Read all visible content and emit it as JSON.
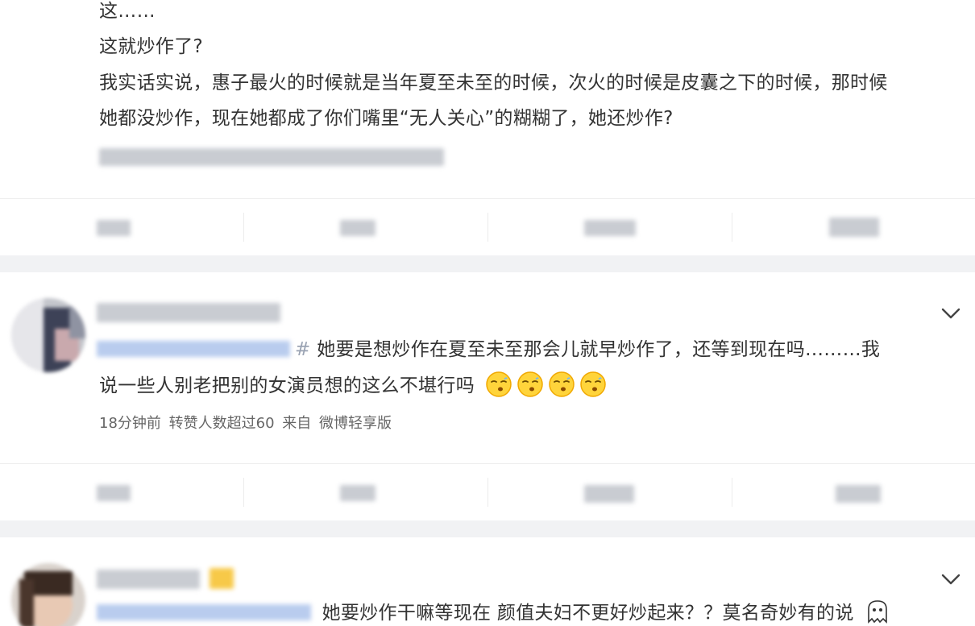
{
  "post": {
    "lines": [
      "这……",
      "这就炒作了?",
      "我实话实说，惠子最火的时候就是当年夏至未至的时候，次火的时候是皮囊之下的时候，那时候",
      "她都没炒作，现在她都成了你们嘴里“无人关心”的糊糊了，她还炒作?"
    ]
  },
  "comments": [
    {
      "hash": "#",
      "text_line1": "她要是想炒作在夏至未至那会儿就早炒作了，还等到现在吗………我",
      "text_line2": "说一些人别老把别的女演员想的这么不堪行吗",
      "meta": "18分钟前  转赞人数超过60  来自 微博轻享版"
    },
    {
      "text_line1": "她要炒作干嘛等现在 颜值夫妇不更好炒起来？？莫名奇妙有的说"
    }
  ],
  "icons": {
    "more": "chevron-down-icon",
    "emoji": "sleepy-face-emoji-icon",
    "badge": "vip-badge-icon",
    "ghost": "ghost-emoji-icon"
  },
  "colors": {
    "background": "#ffffff",
    "gap": "#f1f2f4",
    "text": "#333333",
    "meta": "#666666",
    "blurred_username": "#b9ccee"
  }
}
